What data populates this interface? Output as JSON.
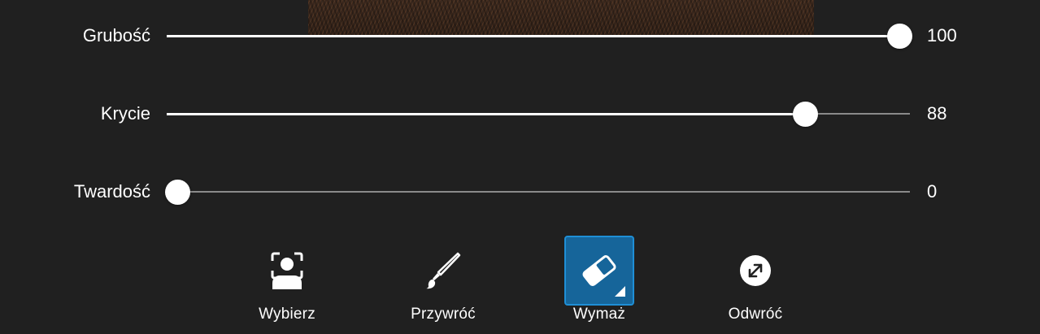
{
  "sliders": [
    {
      "id": "thickness",
      "label": "Grubość",
      "value": "100",
      "fraction": 1.0
    },
    {
      "id": "opacity",
      "label": "Krycie",
      "value": "88",
      "fraction": 0.87
    },
    {
      "id": "hardness",
      "label": "Twardość",
      "value": "0",
      "fraction": 0.0
    }
  ],
  "tools": [
    {
      "id": "select",
      "label": "Wybierz",
      "icon": "person-select-icon",
      "active": false
    },
    {
      "id": "restore",
      "label": "Przywróć",
      "icon": "brush-icon",
      "active": false
    },
    {
      "id": "erase",
      "label": "Wymaż",
      "icon": "eraser-icon",
      "active": true
    },
    {
      "id": "invert",
      "label": "Odwróć",
      "icon": "invert-icon",
      "active": false
    }
  ],
  "colors": {
    "background": "#202020",
    "active_tool": "#16659a",
    "active_tool_border": "#1f8fd6",
    "track_fill": "#ffffff",
    "track_empty": "#8a8a8a"
  }
}
